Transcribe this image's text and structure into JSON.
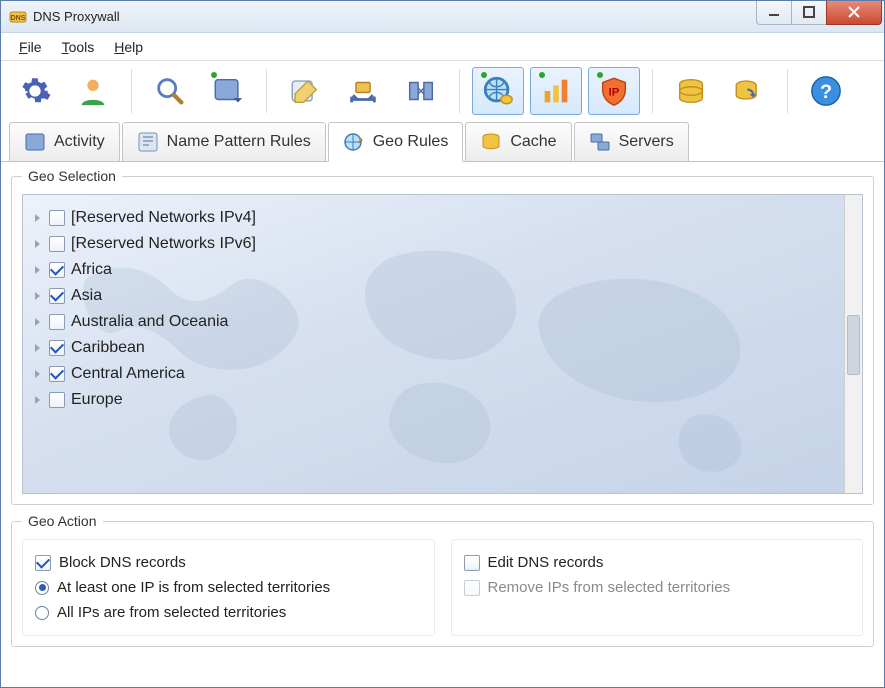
{
  "title": "DNS Proxywall",
  "menu": {
    "file": "File",
    "tools": "Tools",
    "help": "Help"
  },
  "tabs": {
    "activity": "Activity",
    "name_pattern": "Name Pattern Rules",
    "geo_rules": "Geo Rules",
    "cache": "Cache",
    "servers": "Servers"
  },
  "geo_selection": {
    "legend": "Geo Selection",
    "items": [
      {
        "label": "[Reserved Networks IPv4]",
        "checked": false
      },
      {
        "label": "[Reserved Networks IPv6]",
        "checked": false
      },
      {
        "label": "Africa",
        "checked": true
      },
      {
        "label": "Asia",
        "checked": true
      },
      {
        "label": "Australia and Oceania",
        "checked": false
      },
      {
        "label": "Caribbean",
        "checked": true
      },
      {
        "label": "Central America",
        "checked": true
      },
      {
        "label": "Europe",
        "checked": false
      }
    ]
  },
  "geo_action": {
    "legend": "Geo Action",
    "block_dns": "Block DNS records",
    "edit_dns": "Edit DNS records",
    "at_least_one": "At least one IP is from selected territories",
    "all_ips": "All IPs are from selected territories",
    "remove_ips": "Remove IPs from selected territories"
  }
}
